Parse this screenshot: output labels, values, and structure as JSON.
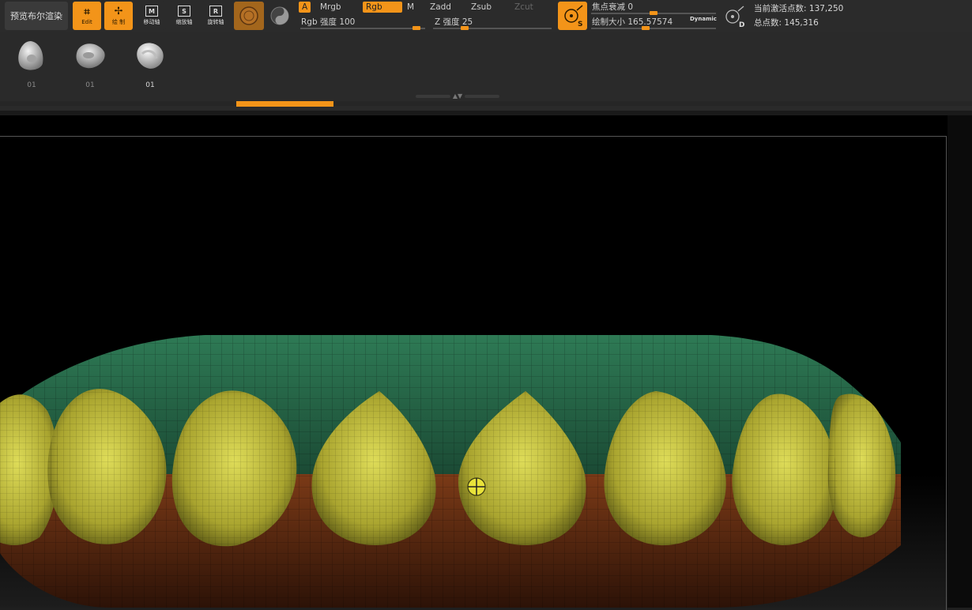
{
  "toolbar": {
    "preview_render": "预览布尔渲染",
    "edit": {
      "glyph": "⌜⌟",
      "label": "Edit"
    },
    "draw": {
      "glyph": "✢",
      "label": "绘 制"
    },
    "move": {
      "glyph": "M",
      "label": "移动轴"
    },
    "scale": {
      "glyph": "S",
      "label": "缩放轴"
    },
    "rotate": {
      "glyph": "R",
      "label": "旋转轴"
    },
    "toggles": {
      "a": "A",
      "mrgb": "Mrgb",
      "rgb": "Rgb",
      "m": "M",
      "zadd": "Zadd",
      "zsub": "Zsub",
      "zcut": "Zcut"
    },
    "rgb_intensity": {
      "label": "Rgb 强度",
      "value": 100,
      "fraction": 0.96
    },
    "z_intensity": {
      "label": "Z 强度",
      "value": 25,
      "fraction": 0.25
    },
    "focal_shift": {
      "label": "焦点衰减",
      "value": 0,
      "fraction": 0.5
    },
    "draw_size": {
      "label": "绘制大小",
      "value": 165.57574,
      "fraction": 0.43
    },
    "sym_button": "S",
    "dynamic": "Dynamic",
    "d_button": "D"
  },
  "stats": {
    "active_points_label": "当前激活点数:",
    "active_points": "137,250",
    "total_points_label": "总点数:",
    "total_points": "145,316"
  },
  "brushes": [
    {
      "label": "01"
    },
    {
      "label": "01"
    },
    {
      "label": "01"
    }
  ],
  "colors": {
    "accent": "#f39419",
    "base_top": "#1f5a3f",
    "base_bottom": "#6a2e14",
    "bud": "#b9b23b"
  }
}
